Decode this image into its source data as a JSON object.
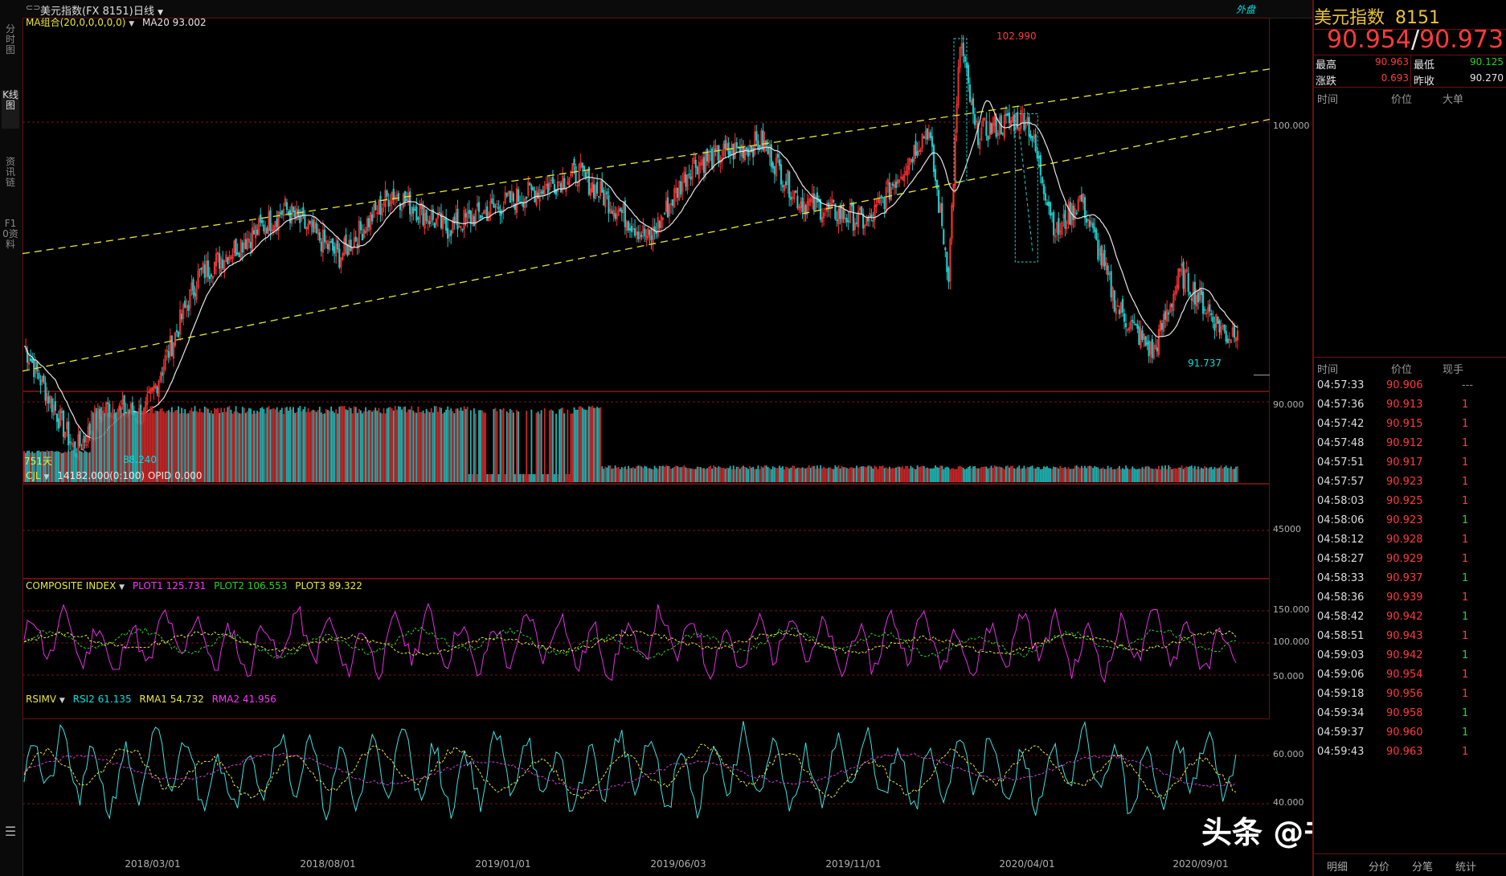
{
  "leftbar": {
    "tabs": [
      "分时图",
      "K线图",
      "资讯链",
      "F10资料"
    ],
    "menu_glyph": "☰"
  },
  "topbar": {
    "symbol": "美元指数(FX 8151)",
    "period": "日线",
    "right_mark": "外盘"
  },
  "main": {
    "ma_legend": "MA组合(20,0,0,0,0,0)",
    "ma_value": "MA20 93.002",
    "high_label": "102.990",
    "low_label": "88.240",
    "last_low_label": "91.737",
    "days_label": "751天",
    "axis_ticks": [
      "100.000",
      "90.000"
    ]
  },
  "volume": {
    "legend": "CJL",
    "info": "14182.000(0:100)  OPID 0.000",
    "axis_tick": "45000"
  },
  "composite": {
    "legend": "COMPOSITE INDEX",
    "p1": "PLOT1 125.731",
    "p2": "PLOT2 106.553",
    "p3": "PLOT3 89.322",
    "axis_ticks": [
      "150.000",
      "100.000",
      "50.000"
    ]
  },
  "rsimv": {
    "legend": "RSIMV",
    "rsi2": "RSI2 61.135",
    "rma1": "RMA1 54.732",
    "rma2": "RMA2 41.956",
    "axis_ticks": [
      "60.000",
      "40.000"
    ]
  },
  "x_dates": [
    "2018/03/01",
    "2018/08/01",
    "2019/01/01",
    "2019/06/03",
    "2019/11/01",
    "2020/04/01",
    "2020/09/01"
  ],
  "right_panel": {
    "name": "美元指数",
    "code": "8151",
    "price": "90.954",
    "price2": "90.973",
    "high_label": "最高",
    "high": "90.963",
    "low_label": "最低",
    "low": "90.125",
    "chg_label": "涨跌",
    "chg": "0.693",
    "prev_label": "昨收",
    "prev": "90.270",
    "big_headers": [
      "时间",
      "价位",
      "大单"
    ],
    "trade_headers": [
      "时间",
      "价位",
      "现手"
    ],
    "trades": [
      {
        "t": "04:57:33",
        "p": "90.906",
        "v": "---"
      },
      {
        "t": "04:57:36",
        "p": "90.913",
        "v": "1"
      },
      {
        "t": "04:57:42",
        "p": "90.915",
        "v": "1"
      },
      {
        "t": "04:57:48",
        "p": "90.912",
        "v": "1"
      },
      {
        "t": "04:57:51",
        "p": "90.917",
        "v": "1"
      },
      {
        "t": "04:57:57",
        "p": "90.923",
        "v": "1"
      },
      {
        "t": "04:58:03",
        "p": "90.925",
        "v": "1"
      },
      {
        "t": "04:58:06",
        "p": "90.923",
        "v": "1"
      },
      {
        "t": "04:58:12",
        "p": "90.928",
        "v": "1"
      },
      {
        "t": "04:58:27",
        "p": "90.929",
        "v": "1"
      },
      {
        "t": "04:58:33",
        "p": "90.937",
        "v": "1"
      },
      {
        "t": "04:58:36",
        "p": "90.939",
        "v": "1"
      },
      {
        "t": "04:58:42",
        "p": "90.942",
        "v": "1"
      },
      {
        "t": "04:58:51",
        "p": "90.943",
        "v": "1"
      },
      {
        "t": "04:59:03",
        "p": "90.942",
        "v": "1"
      },
      {
        "t": "04:59:06",
        "p": "90.954",
        "v": "1"
      },
      {
        "t": "04:59:18",
        "p": "90.956",
        "v": "1"
      },
      {
        "t": "04:59:34",
        "p": "90.958",
        "v": "1"
      },
      {
        "t": "04:59:37",
        "p": "90.960",
        "v": "1"
      },
      {
        "t": "04:59:43",
        "p": "90.963",
        "v": "1"
      }
    ],
    "trade_vol_colors": [
      "grey",
      "red",
      "red",
      "red",
      "red",
      "red",
      "red",
      "green",
      "red",
      "red",
      "green",
      "red",
      "green",
      "red",
      "green",
      "red",
      "red",
      "green",
      "green",
      "red"
    ],
    "bottom_tabs": [
      "明细",
      "分价",
      "分笔",
      "统计"
    ]
  },
  "watermark": "头条 @书痴半枚",
  "chart_data": {
    "type": "candlestick",
    "instrument": "美元指数",
    "period": "日线",
    "y_ticks": [
      100,
      90
    ],
    "x_ticks": [
      "2018/03/01",
      "2018/08/01",
      "2019/01/01",
      "2019/06/03",
      "2019/11/01",
      "2020/04/01",
      "2020/09/01"
    ],
    "anchors": [
      {
        "x": "2018/01/02",
        "close": 92.0
      },
      {
        "x": "2018/02/15",
        "close": 88.24
      },
      {
        "x": "2018/03/15",
        "close": 89.8
      },
      {
        "x": "2018/04/15",
        "close": 89.5
      },
      {
        "x": "2018/06/01",
        "close": 94.5
      },
      {
        "x": "2018/08/15",
        "close": 96.9
      },
      {
        "x": "2018/10/01",
        "close": 95.2
      },
      {
        "x": "2018/11/15",
        "close": 97.5
      },
      {
        "x": "2019/01/01",
        "close": 96.2
      },
      {
        "x": "2019/02/15",
        "close": 97.0
      },
      {
        "x": "2019/04/25",
        "close": 98.2
      },
      {
        "x": "2019/06/25",
        "close": 95.8
      },
      {
        "x": "2019/08/01",
        "close": 98.5
      },
      {
        "x": "2019/09/30",
        "close": 99.3
      },
      {
        "x": "2019/11/01",
        "close": 97.2
      },
      {
        "x": "2019/12/31",
        "close": 96.4
      },
      {
        "x": "2020/02/20",
        "close": 99.8
      },
      {
        "x": "2020/03/09",
        "close": 94.6
      },
      {
        "x": "2020/03/19",
        "close": 102.99
      },
      {
        "x": "2020/04/01",
        "close": 99.6
      },
      {
        "x": "2020/05/15",
        "close": 100.2
      },
      {
        "x": "2020/06/10",
        "close": 96.0
      },
      {
        "x": "2020/07/01",
        "close": 97.3
      },
      {
        "x": "2020/08/01",
        "close": 93.4
      },
      {
        "x": "2020/09/01",
        "close": 91.737
      },
      {
        "x": "2020/09/25",
        "close": 94.6
      },
      {
        "x": "2020/11/05",
        "close": 92.3
      },
      {
        "x": "2020/11/13",
        "close": 92.8
      }
    ],
    "annotations": {
      "high": 102.99,
      "low": 88.24,
      "last_low": 91.737,
      "ma20": 93.002
    },
    "volume_tick": 45000,
    "composite": {
      "plot1": 125.731,
      "plot2": 106.553,
      "plot3": 89.322,
      "ticks": [
        150,
        100,
        50
      ]
    },
    "rsimv": {
      "rsi2": 61.135,
      "rma1": 54.732,
      "rma2": 41.956,
      "ticks": [
        60,
        40
      ]
    }
  }
}
